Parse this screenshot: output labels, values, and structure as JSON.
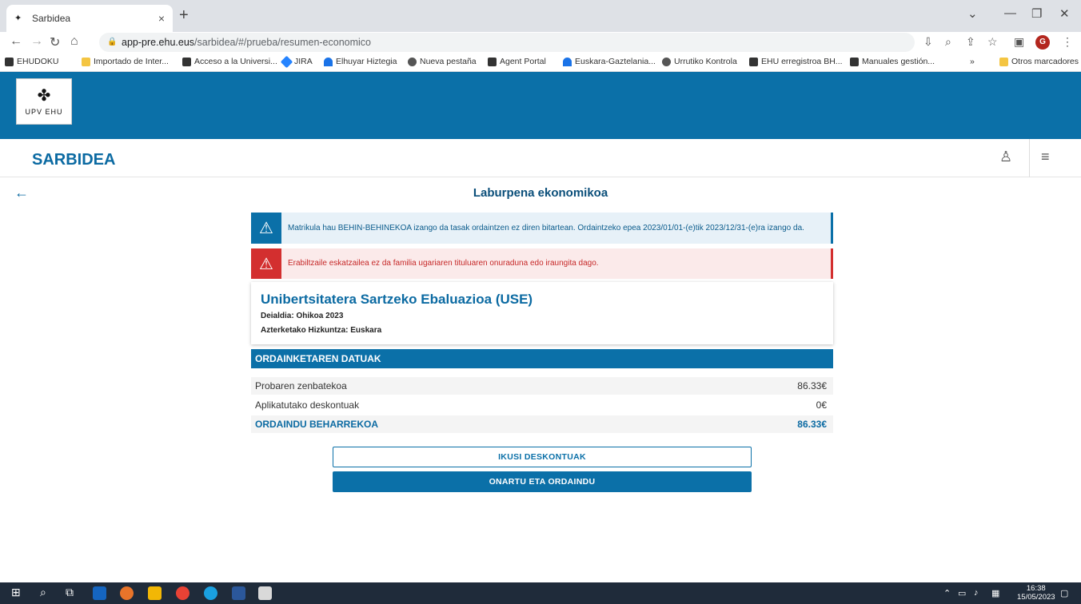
{
  "browser": {
    "tab_title": "Sarbidea",
    "tab_close": "×",
    "new_tab": "+",
    "url_host": "app-pre.ehu.eus",
    "url_path": "/sarbidea/#/prueba/resumen-economico",
    "profile_initial": "G",
    "bookmarks": [
      {
        "label": "EHUDOKU",
        "color": "#333333"
      },
      {
        "label": "Importado de Inter...",
        "color": "#f4c542"
      },
      {
        "label": "Acceso a la Universi...",
        "color": "#333333"
      },
      {
        "label": "JIRA",
        "color": "#2684ff"
      },
      {
        "label": "Elhuyar Hiztegia",
        "color": "#1a73e8"
      },
      {
        "label": "Nueva pestaña",
        "color": "#555555"
      },
      {
        "label": "Agent Portal",
        "color": "#333333"
      },
      {
        "label": "Euskara-Gaztelania...",
        "color": "#1a73e8"
      },
      {
        "label": "Urrutiko Kontrola",
        "color": "#555555"
      },
      {
        "label": "EHU erregistroa BH...",
        "color": "#333333"
      },
      {
        "label": "Manuales gestión...",
        "color": "#333333"
      }
    ],
    "bookmarks_more": "»",
    "other_bookmarks": "Otros marcadores"
  },
  "header": {
    "logo_text": "UPV  EHU",
    "app_title": "SARBIDEA"
  },
  "page": {
    "title": "Laburpena ekonomikoa"
  },
  "alerts": {
    "info": "Matrikula hau BEHIN-BEHINEKOA izango da tasak ordaintzen ez diren bitartean. Ordaintzeko epea 2023/01/01-(e)tik 2023/12/31-(e)ra izango da.",
    "error": "Erabiltzaile eskatzailea ez da familia ugariaren tituluaren onuraduna edo iraungita dago."
  },
  "exam": {
    "title": "Unibertsitatera Sartzeko Ebaluazioa (USE)",
    "call": "Deialdia: Ohikoa 2023",
    "language": "Azterketako Hizkuntza: Euskara"
  },
  "payment": {
    "header": "ORDAINKETAREN DATUAK",
    "rows": [
      {
        "label": "Probaren zenbatekoa",
        "value": "86.33€"
      },
      {
        "label": "Aplikatutako deskontuak",
        "value": "0€"
      },
      {
        "label": "ORDAINDU BEHARREKOA",
        "value": "86.33€"
      }
    ]
  },
  "buttons": {
    "view_discounts": "IKUSI DESKONTUAK",
    "accept_pay": "ONARTU ETA ORDAINDU"
  },
  "taskbar": {
    "time": "16:38",
    "date": "15/05/2023"
  },
  "colors": {
    "brand": "#0b70a8",
    "error": "#d32f2f"
  }
}
